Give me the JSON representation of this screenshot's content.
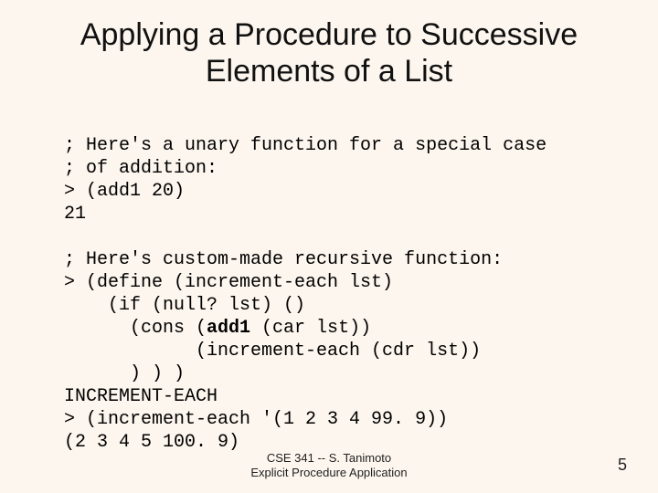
{
  "title_line1": "Applying a Procedure to Successive",
  "title_line2": "Elements of a List",
  "block1": {
    "l1": "; Here's a unary function for a special case",
    "l2": "; of addition:",
    "l3": "> (add1 20)",
    "l4": "21"
  },
  "block2": {
    "l1": "; Here's custom-made recursive function:",
    "l2": "> (define (increment-each lst)",
    "l3": "    (if (null? lst) ()",
    "l4a": "      (cons (",
    "l4b": "add1",
    "l4c": " (car lst))",
    "l5": "            (increment-each (cdr lst))",
    "l6": "      ) ) )",
    "l7": "INCREMENT-EACH",
    "l8": "> (increment-each '(1 2 3 4 99. 9))",
    "l9": "(2 3 4 5 100. 9)"
  },
  "footer_line1": "CSE 341 -- S. Tanimoto",
  "footer_line2": "Explicit Procedure Application",
  "pagenum": "5"
}
